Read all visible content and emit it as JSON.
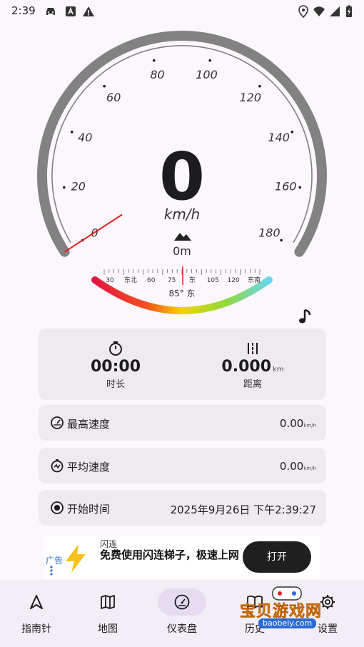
{
  "status_bar": {
    "time": "2:39",
    "left_icons": [
      "car-icon",
      "font-a-icon",
      "warning-icon"
    ],
    "right_icons": [
      "location-icon",
      "wifi-icon",
      "signal-icon",
      "battery-charging-icon"
    ]
  },
  "gauge": {
    "speed": "0",
    "unit": "km/h",
    "altitude": "0m",
    "max_speed": 180,
    "tick_labels": [
      "0",
      "20",
      "40",
      "60",
      "80",
      "100",
      "120",
      "140",
      "160",
      "180"
    ],
    "current_speed_value": 0,
    "compass_labels": [
      "30",
      "东北",
      "60",
      "75",
      "东",
      "105",
      "120",
      "东南"
    ],
    "heading": "85° 东",
    "heading_degrees": 85,
    "colors": {
      "ring": "#828282",
      "needle": "#e0201f",
      "arc_start": "#e3173f",
      "arc_mid": "#f6d400",
      "arc_end": "#6ad6f0"
    }
  },
  "stats": {
    "duration_value": "00:00",
    "duration_label": "时长",
    "distance_value": "0.000",
    "distance_unit": "km",
    "distance_label": "距离"
  },
  "rows": {
    "max_speed": {
      "label": "最高速度",
      "value": "0.00",
      "unit": "km/h"
    },
    "avg_speed": {
      "label": "平均速度",
      "value": "0.00",
      "unit": "km/h"
    },
    "start_time": {
      "label": "开始时间",
      "value": "2025年9月26日 下午2:39:27"
    }
  },
  "ad": {
    "tag": "广告",
    "brand": "闪连",
    "description": "免费使用闪连梯子，极速上网",
    "button": "打开"
  },
  "nav": {
    "items": [
      {
        "label": "指南针",
        "icon": "navigation-arrow-icon"
      },
      {
        "label": "地图",
        "icon": "map-icon"
      },
      {
        "label": "仪表盘",
        "icon": "speedometer-icon"
      },
      {
        "label": "历史",
        "icon": "book-icon"
      },
      {
        "label": "设置",
        "icon": "gear-icon"
      }
    ],
    "active_index": 2
  },
  "watermark": {
    "text": "宝贝游戏网",
    "url": "baobeiy.com"
  }
}
